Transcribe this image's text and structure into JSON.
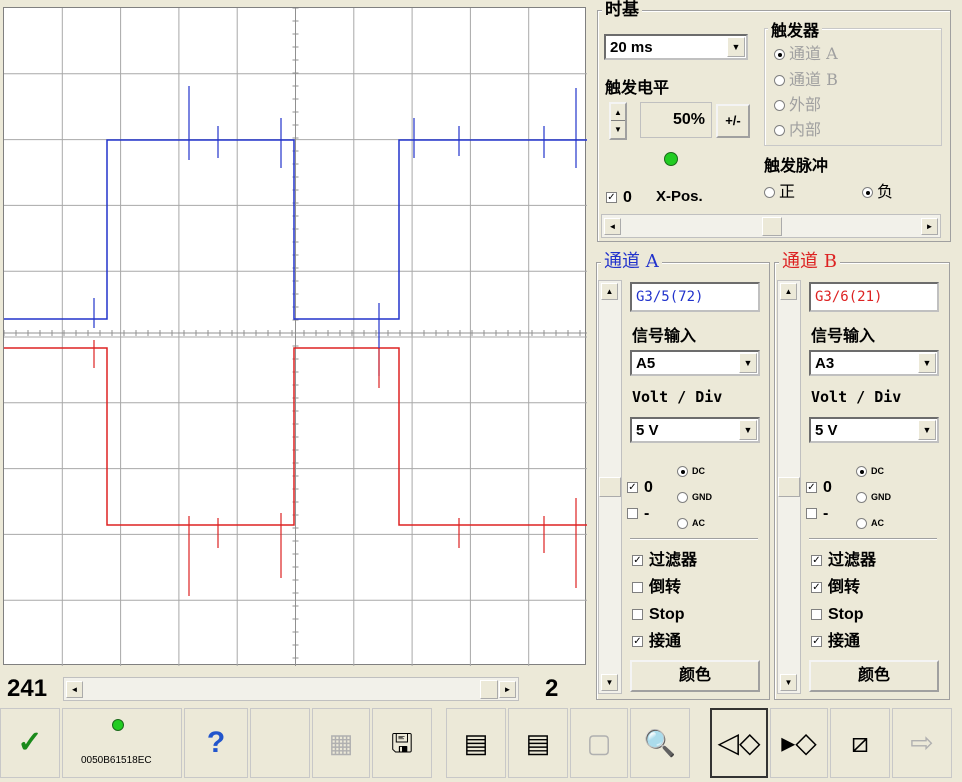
{
  "timebase": {
    "title": "时基",
    "value": "20 ms"
  },
  "trigger_level": {
    "title": "触发电平",
    "value": "50%",
    "plusminus": "+/-"
  },
  "trigger": {
    "title": "触发器",
    "options": [
      "通道 A",
      "通道 B",
      "外部",
      "内部"
    ],
    "selected": "通道 A"
  },
  "trigger_pulse": {
    "title": "触发脉冲",
    "positive": "正",
    "negative": "负",
    "selected": "负"
  },
  "xpos": {
    "checked_label": "0",
    "label": "X-Pos."
  },
  "channel_a": {
    "title": "通道 A",
    "id_value": "G3/5(72)",
    "signal_label": "信号输入",
    "signal_value": "A5",
    "volt_label": "Volt / Div",
    "volt_value": "5 V",
    "zero_label": "0",
    "minus_label": "-",
    "coupling": [
      "DC",
      "GND",
      "AC"
    ],
    "coupling_selected": "DC",
    "filter": "过滤器",
    "filter_checked": true,
    "invert": "倒转",
    "invert_checked": false,
    "stop": "Stop",
    "stop_checked": false,
    "connect": "接通",
    "connect_checked": true,
    "color": "颜色",
    "color_hex": "#2233cc"
  },
  "channel_b": {
    "title": "通道 B",
    "id_value": "G3/6(21)",
    "signal_label": "信号输入",
    "signal_value": "A3",
    "volt_label": "Volt / Div",
    "volt_value": "5 V",
    "zero_label": "0",
    "minus_label": "-",
    "coupling": [
      "DC",
      "GND",
      "AC"
    ],
    "coupling_selected": "DC",
    "filter": "过滤器",
    "filter_checked": true,
    "invert": "倒转",
    "invert_checked": true,
    "stop": "Stop",
    "stop_checked": false,
    "connect": "接通",
    "connect_checked": true,
    "color": "颜色",
    "color_hex": "#dd2222"
  },
  "scrollbar": {
    "left_value": "241",
    "right_value": "2"
  },
  "device_id": "0050B61518EC",
  "status_led_color": "#22cc22",
  "toolbar_icons": [
    "confirm-check-icon",
    "help-icon",
    "save-picture-icon",
    "save-gif-icon",
    "import-icon",
    "export-icon",
    "blank-page-icon",
    "zoom-icon",
    "diamond-left-icon",
    "diamond-right-icon",
    "diamond-cross-icon",
    "arrow-exit-icon"
  ]
}
